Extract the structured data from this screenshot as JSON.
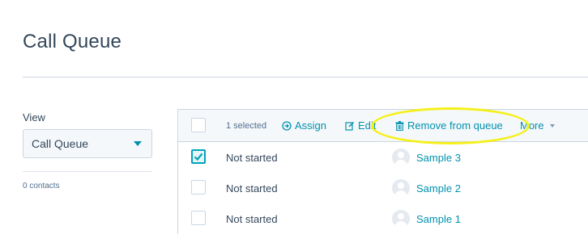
{
  "page": {
    "title": "Call Queue"
  },
  "sidebar": {
    "view_label": "View",
    "view_select_value": "Call Queue",
    "contact_count": "0 contacts"
  },
  "table": {
    "header": {
      "selected_count": "1 selected",
      "actions": {
        "assign": "Assign",
        "edit": "Edit",
        "remove": "Remove from queue",
        "more": "More"
      }
    },
    "rows": [
      {
        "checked": true,
        "status": "Not started",
        "contact": "Sample 3"
      },
      {
        "checked": false,
        "status": "Not started",
        "contact": "Sample 2"
      },
      {
        "checked": false,
        "status": "Not started",
        "contact": "Sample 1"
      }
    ]
  },
  "colors": {
    "accent": "#0091ae",
    "checkbox_checked": "#00a4bd",
    "highlight": "#f5f01a"
  }
}
